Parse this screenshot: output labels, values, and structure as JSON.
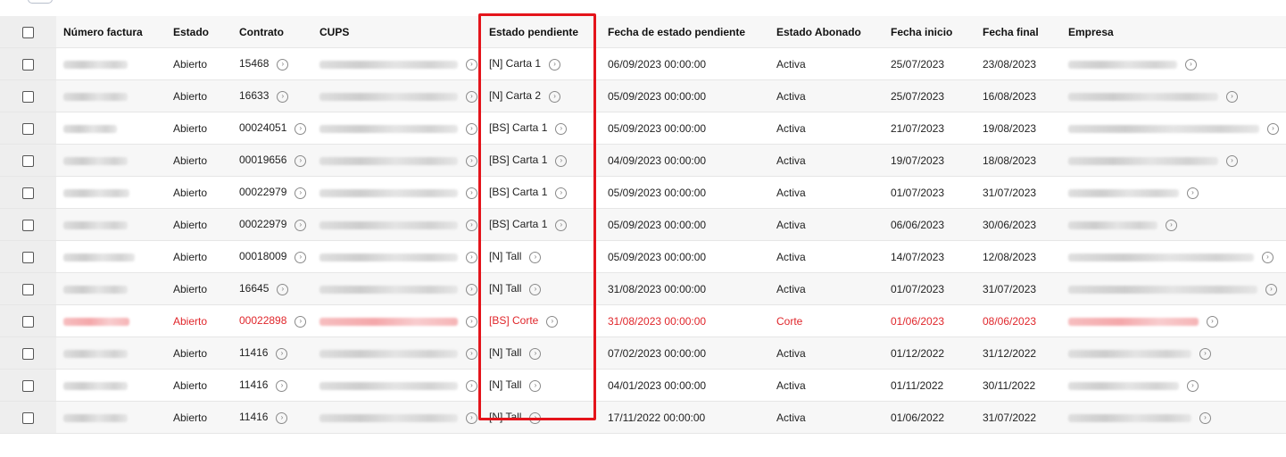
{
  "columns": {
    "numero_factura": "Número factura",
    "estado": "Estado",
    "contrato": "Contrato",
    "cups": "CUPS",
    "estado_pendiente": "Estado pendiente",
    "fecha_estado_pendiente": "Fecha de estado pendiente",
    "estado_abonado": "Estado Abonado",
    "fecha_inicio": "Fecha inicio",
    "fecha_final": "Fecha final",
    "empresa": "Empresa"
  },
  "rows": [
    {
      "estado": "Abierto",
      "contrato": "15468",
      "estado_pendiente": "[N] Carta 1",
      "fecha_estado_pendiente": "06/09/2023 00:00:00",
      "estado_abonado": "Activa",
      "fecha_inicio": "25/07/2023",
      "fecha_final": "23/08/2023"
    },
    {
      "estado": "Abierto",
      "contrato": "16633",
      "estado_pendiente": "[N] Carta 2",
      "fecha_estado_pendiente": "05/09/2023 00:00:00",
      "estado_abonado": "Activa",
      "fecha_inicio": "25/07/2023",
      "fecha_final": "16/08/2023"
    },
    {
      "estado": "Abierto",
      "contrato": "00024051",
      "estado_pendiente": "[BS] Carta 1",
      "fecha_estado_pendiente": "05/09/2023 00:00:00",
      "estado_abonado": "Activa",
      "fecha_inicio": "21/07/2023",
      "fecha_final": "19/08/2023"
    },
    {
      "estado": "Abierto",
      "contrato": "00019656",
      "estado_pendiente": "[BS] Carta 1",
      "fecha_estado_pendiente": "04/09/2023 00:00:00",
      "estado_abonado": "Activa",
      "fecha_inicio": "19/07/2023",
      "fecha_final": "18/08/2023"
    },
    {
      "estado": "Abierto",
      "contrato": "00022979",
      "estado_pendiente": "[BS] Carta 1",
      "fecha_estado_pendiente": "05/09/2023 00:00:00",
      "estado_abonado": "Activa",
      "fecha_inicio": "01/07/2023",
      "fecha_final": "31/07/2023"
    },
    {
      "estado": "Abierto",
      "contrato": "00022979",
      "estado_pendiente": "[BS] Carta 1",
      "fecha_estado_pendiente": "05/09/2023 00:00:00",
      "estado_abonado": "Activa",
      "fecha_inicio": "06/06/2023",
      "fecha_final": "30/06/2023"
    },
    {
      "estado": "Abierto",
      "contrato": "00018009",
      "estado_pendiente": "[N] Tall",
      "fecha_estado_pendiente": "05/09/2023 00:00:00",
      "estado_abonado": "Activa",
      "fecha_inicio": "14/07/2023",
      "fecha_final": "12/08/2023"
    },
    {
      "estado": "Abierto",
      "contrato": "16645",
      "estado_pendiente": "[N] Tall",
      "fecha_estado_pendiente": "31/08/2023 00:00:00",
      "estado_abonado": "Activa",
      "fecha_inicio": "01/07/2023",
      "fecha_final": "31/07/2023"
    },
    {
      "estado": "Abierto",
      "contrato": "00022898",
      "estado_pendiente": "[BS] Corte",
      "fecha_estado_pendiente": "31/08/2023 00:00:00",
      "estado_abonado": "Corte",
      "fecha_inicio": "01/06/2023",
      "fecha_final": "08/06/2023"
    },
    {
      "estado": "Abierto",
      "contrato": "11416",
      "estado_pendiente": "[N] Tall",
      "fecha_estado_pendiente": "07/02/2023 00:00:00",
      "estado_abonado": "Activa",
      "fecha_inicio": "01/12/2022",
      "fecha_final": "31/12/2022"
    },
    {
      "estado": "Abierto",
      "contrato": "11416",
      "estado_pendiente": "[N] Tall",
      "fecha_estado_pendiente": "04/01/2023 00:00:00",
      "estado_abonado": "Activa",
      "fecha_inicio": "01/11/2022",
      "fecha_final": "30/11/2022"
    },
    {
      "estado": "Abierto",
      "contrato": "11416",
      "estado_pendiente": "[N] Tall",
      "fecha_estado_pendiente": "17/11/2022 00:00:00",
      "estado_abonado": "Activa",
      "fecha_inicio": "01/06/2022",
      "fecha_final": "31/07/2022"
    }
  ],
  "colors": {
    "alert": "#e0262b",
    "highlight": "#e4141b"
  },
  "icons": {
    "detail_link": "circle-arrow-right-icon"
  }
}
